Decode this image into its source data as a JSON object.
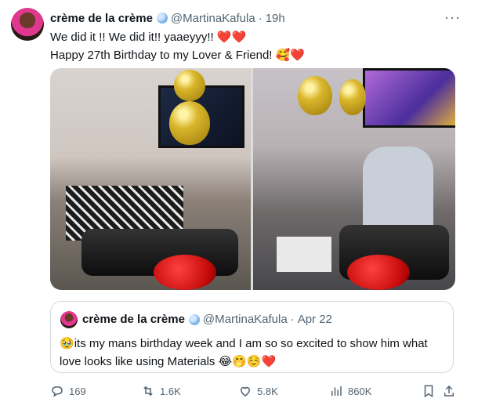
{
  "tweet": {
    "name": "crème de la crème",
    "handle": "@MartinaKafula",
    "time": "19h",
    "line1": "We did it !! We did it!!  yaaeyyy!! ",
    "line1_emoji": "❤️❤️",
    "line2": "Happy 27th Birthday to my Lover & Friend! ",
    "line2_emoji": "🥰❤️"
  },
  "quote": {
    "name": "crème de la crème",
    "handle": "@MartinaKafula",
    "date": "Apr 22",
    "emoji_start": "🥹",
    "text": "its my mans birthday week and I am so so excited to show him what love looks like using Materials ",
    "emoji_end": "😂🤭☺️❤️"
  },
  "actions": {
    "replies": "169",
    "reposts": "1.6K",
    "likes": "5.8K",
    "views": "860K"
  }
}
